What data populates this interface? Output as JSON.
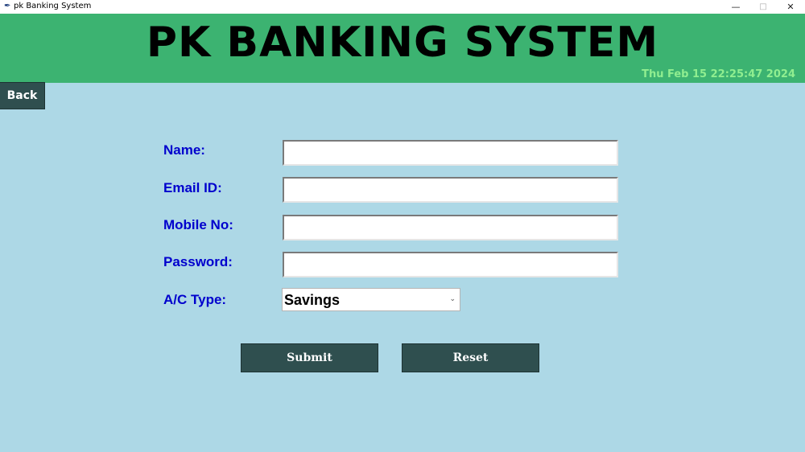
{
  "window": {
    "title": "pk Banking System",
    "icon": "feather-icon",
    "controls": {
      "minimize": "—",
      "maximize": "□",
      "close": "✕"
    }
  },
  "header": {
    "title": "PK BANKING SYSTEM",
    "datetime": "Thu Feb 15 22:25:47 2024",
    "background": "#3cb371",
    "datetime_color": "#90ee90"
  },
  "back_button": {
    "label": "Back"
  },
  "form": {
    "name_label": "Name:",
    "email_label": "Email ID:",
    "mobile_label": "Mobile No:",
    "password_label": "Password:",
    "actype_label": "A/C Type:",
    "name_value": "",
    "email_value": "",
    "mobile_value": "",
    "password_value": "",
    "actype_value": "Savings",
    "label_color": "#0000cd"
  },
  "buttons": {
    "submit": "Submit",
    "reset": "Reset",
    "color": "#2f4f4f"
  },
  "background": "#add8e6"
}
